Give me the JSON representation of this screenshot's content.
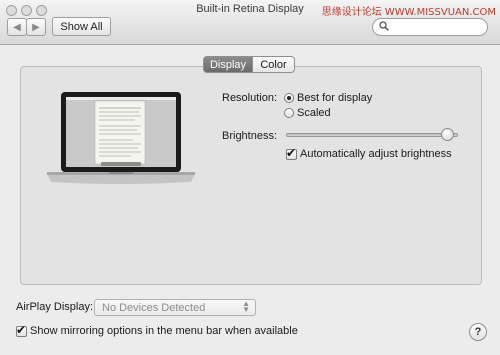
{
  "window": {
    "title": "Built-in Retina Display",
    "watermark": "思缘设计论坛 WWW.MISSVUAN.COM"
  },
  "toolbar": {
    "back_icon": "chevron-left-icon",
    "forward_icon": "chevron-right-icon",
    "show_all_label": "Show All",
    "search_value": "",
    "search_placeholder": ""
  },
  "tabs": [
    {
      "label": "Display",
      "selected": true
    },
    {
      "label": "Color",
      "selected": false
    }
  ],
  "resolution": {
    "label": "Resolution:",
    "options": [
      {
        "label": "Best for display",
        "selected": true
      },
      {
        "label": "Scaled",
        "selected": false
      }
    ]
  },
  "brightness": {
    "label": "Brightness:",
    "level": 0.94,
    "auto_label": "Automatically adjust brightness",
    "auto_checked": true
  },
  "airplay": {
    "label": "AirPlay Display:",
    "selected": "No Devices Detected"
  },
  "mirroring": {
    "label": "Show mirroring options in the menu bar when available",
    "checked": true
  },
  "help_label": "?"
}
